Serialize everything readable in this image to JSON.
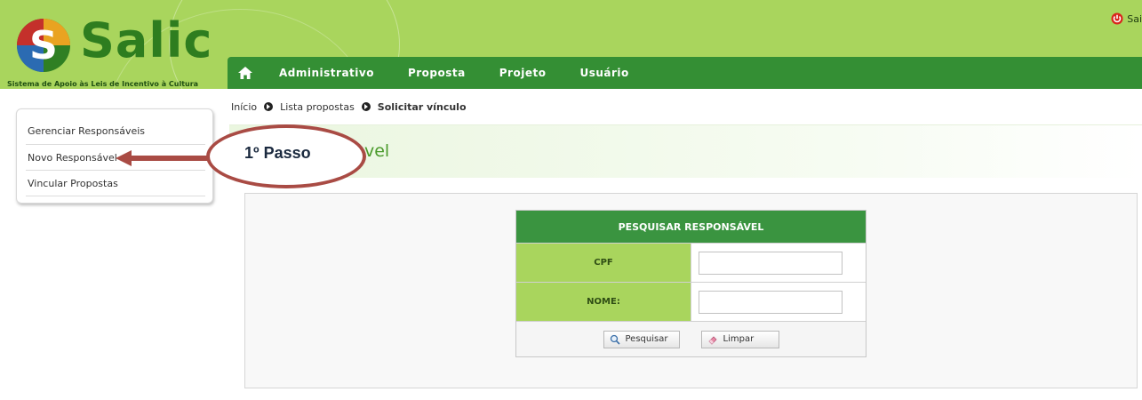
{
  "header": {
    "logo": {
      "brand": "Salic",
      "tagline": "Sistema de Apoio às Leis de Incentivo à Cultura"
    },
    "logout_label": "Sai"
  },
  "nav": {
    "home_icon": "home-icon",
    "items": [
      {
        "label": "Administrativo"
      },
      {
        "label": "Proposta"
      },
      {
        "label": "Projeto"
      },
      {
        "label": "Usuário"
      }
    ]
  },
  "sidebar": {
    "items": [
      {
        "label": "Gerenciar Responsáveis"
      },
      {
        "label": "Novo Responsável"
      },
      {
        "label": "Vincular Propostas"
      }
    ]
  },
  "breadcrumb": {
    "items": [
      {
        "label": "Início"
      },
      {
        "label": "Lista propostas"
      },
      {
        "label": "Solicitar vínculo"
      }
    ]
  },
  "page": {
    "title_visible": "vel"
  },
  "form": {
    "header": "PESQUISAR RESPONSÁVEL",
    "fields": [
      {
        "label": "CPF",
        "value": ""
      },
      {
        "label": "NOME:",
        "value": ""
      }
    ],
    "search_button": "Pesquisar",
    "clear_button": "Limpar"
  },
  "annotation": {
    "label": "1º Passo"
  },
  "colors": {
    "header_green": "#a9d55d",
    "nav_green": "#348f34",
    "form_header_green": "#3a9440",
    "annotation_red": "#a94b44",
    "title_green": "#4a9a2b"
  }
}
